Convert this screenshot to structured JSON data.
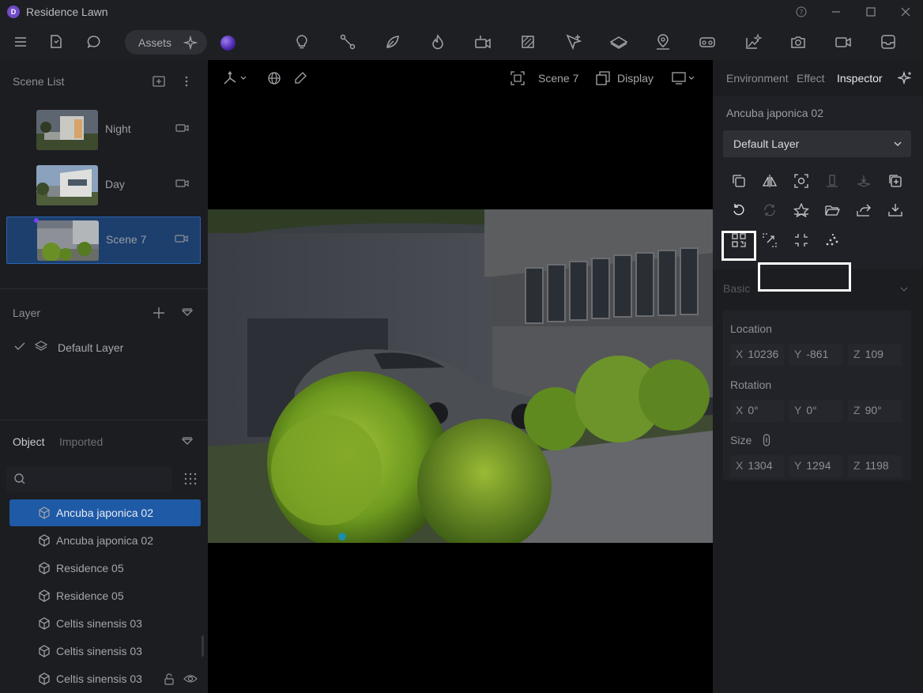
{
  "window": {
    "title": "Residence Lawn",
    "logo_letter": "D"
  },
  "toolbar": {
    "assets_label": "Assets",
    "icons": [
      "menu-icon",
      "file-sync-icon",
      "chat-icon",
      "ai-sparkle-icon",
      "material-orb",
      "light-bulb-icon",
      "path-icon",
      "leaf-icon",
      "fire-icon",
      "camera-path-icon",
      "texture-icon",
      "cursor-plus-icon",
      "plane-icon",
      "map-pin-icon",
      "vr-icon",
      "image-sparkle-icon",
      "camera-icon",
      "video-icon",
      "inbox-icon"
    ]
  },
  "scene_list": {
    "title": "Scene List",
    "items": [
      {
        "name": "Night",
        "active": false
      },
      {
        "name": "Day",
        "active": false
      },
      {
        "name": "Scene 7",
        "active": true
      }
    ]
  },
  "layer_panel": {
    "title": "Layer",
    "items": [
      {
        "name": "Default Layer",
        "checked": true
      }
    ]
  },
  "object_panel": {
    "tabs": [
      "Object",
      "Imported"
    ],
    "search_placeholder": "",
    "items": [
      {
        "name": "Ancuba japonica 02",
        "active": true
      },
      {
        "name": "Ancuba japonica 02",
        "active": false
      },
      {
        "name": "Residence 05",
        "active": false
      },
      {
        "name": "Residence 05",
        "active": false
      },
      {
        "name": "Celtis sinensis 03",
        "active": false
      },
      {
        "name": "Celtis sinensis 03",
        "active": false
      },
      {
        "name": "Celtis sinensis 03",
        "active": false
      }
    ]
  },
  "viewport": {
    "scene_label": "Scene 7",
    "display_label": "Display"
  },
  "inspector": {
    "tabs": [
      "Environment",
      "Effect",
      "Inspector"
    ],
    "active_tab": "Inspector",
    "object_name": "Ancuba japonica 02",
    "layer_value": "Default Layer",
    "section_basic": "Basic",
    "location": {
      "label": "Location",
      "x": "10236",
      "y": "-861",
      "z": "109"
    },
    "rotation": {
      "label": "Rotation",
      "x": "0°",
      "y": "0°",
      "z": "90°"
    },
    "size": {
      "label": "Size",
      "x": "1304",
      "y": "1294",
      "z": "1198"
    },
    "axis_labels": {
      "x": "X",
      "y": "Y",
      "z": "Z"
    }
  },
  "colors": {
    "accent": "#1f5aa6",
    "panel": "#1c1d21",
    "viewport": "#000000"
  }
}
